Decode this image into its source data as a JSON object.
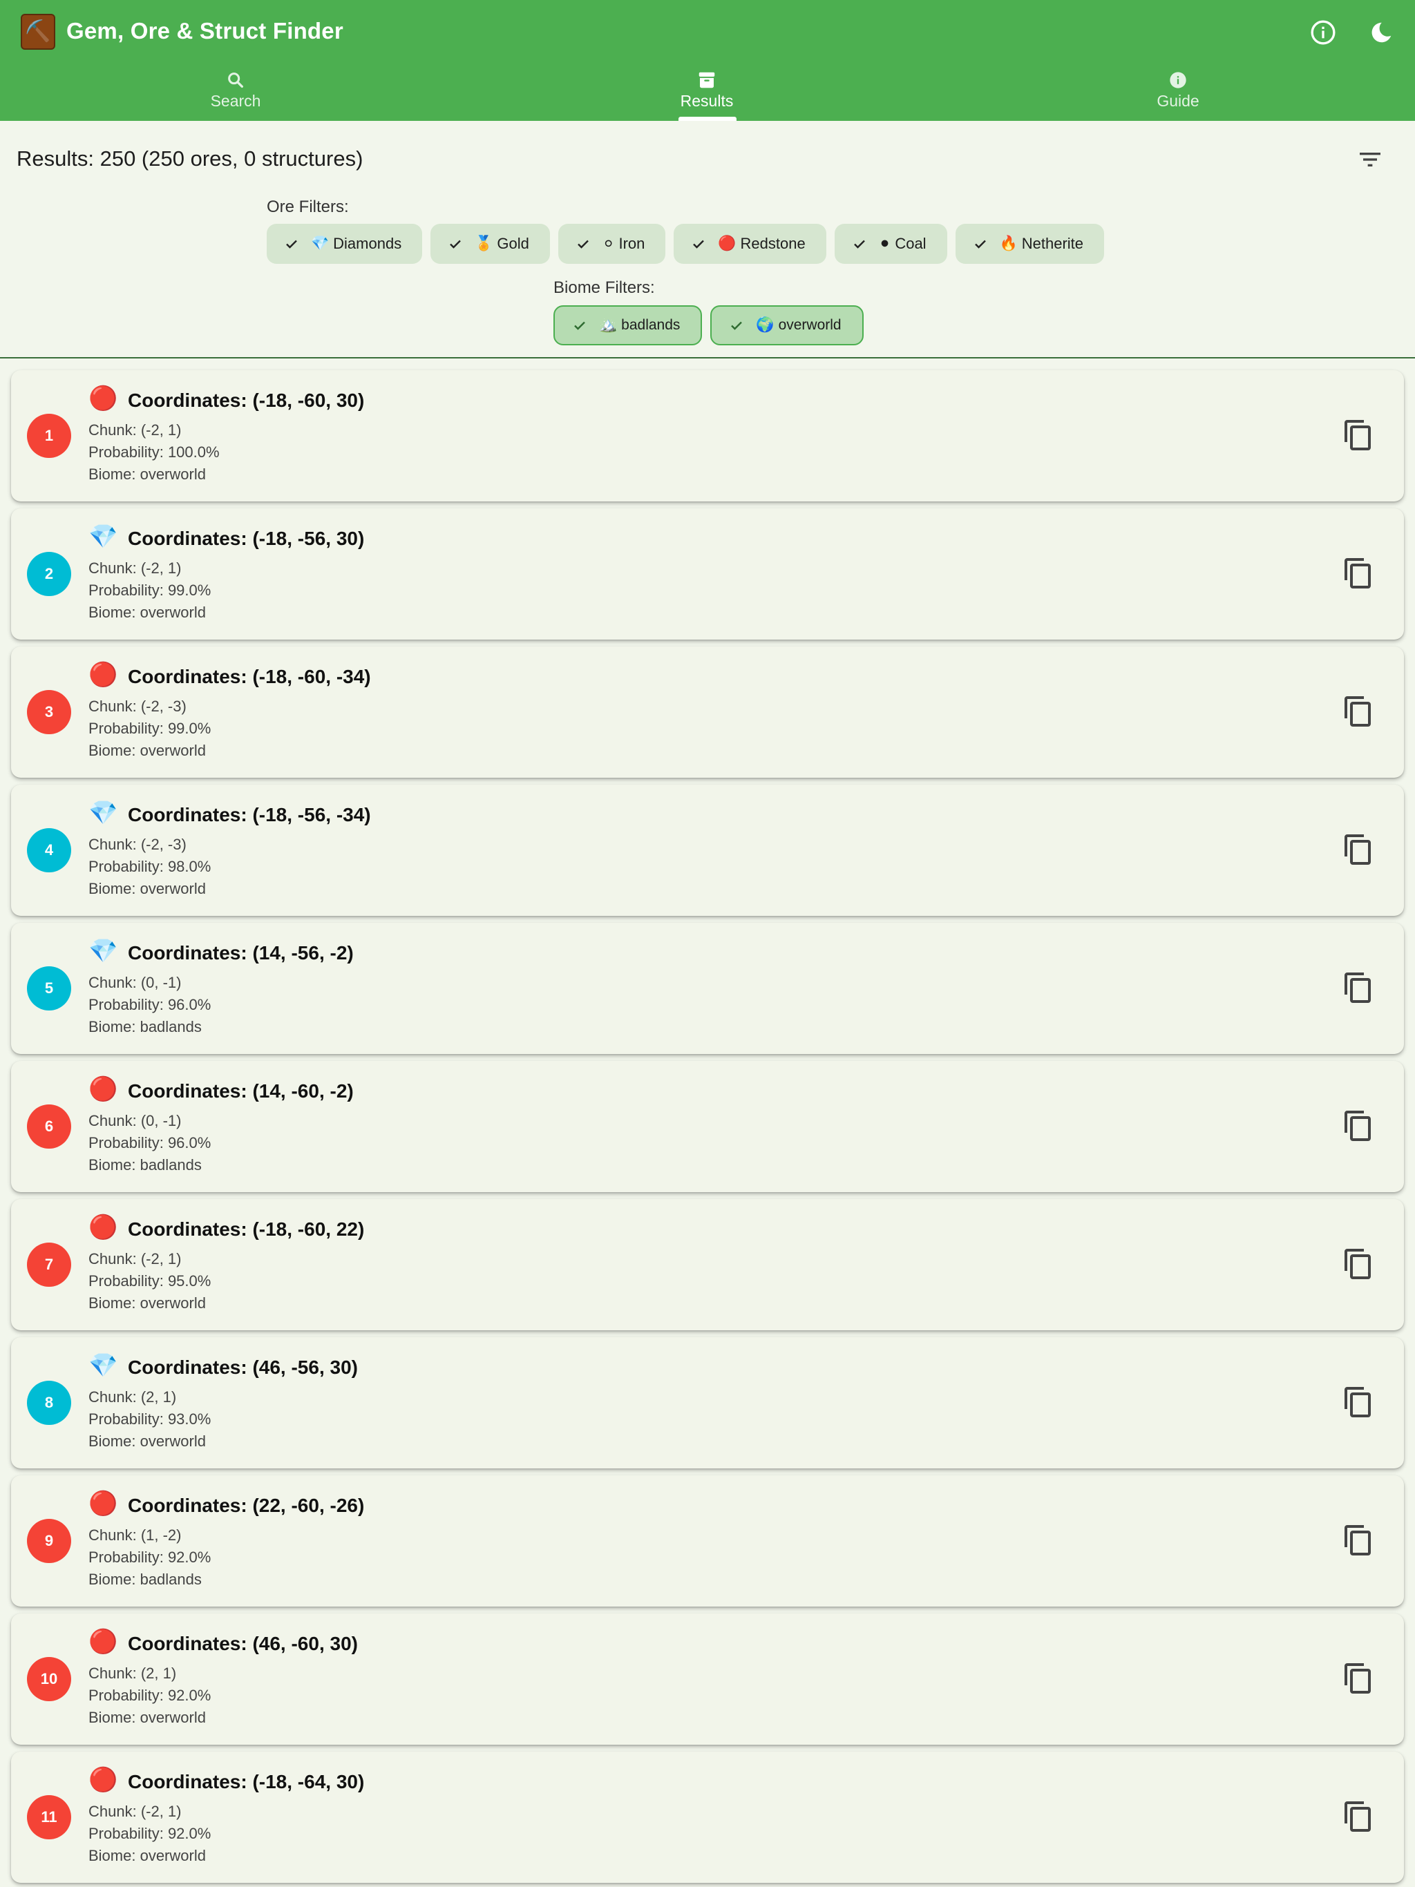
{
  "app": {
    "title": "Gem, Ore & Struct Finder",
    "logo_icon": "⛏️"
  },
  "tabs": [
    {
      "label": "Search",
      "icon": "search-icon"
    },
    {
      "label": "Results",
      "icon": "archive-icon",
      "active": true
    },
    {
      "label": "Guide",
      "icon": "info-icon"
    }
  ],
  "results": {
    "summary": "Results: 250 (250 ores, 0 structures)"
  },
  "filters": {
    "ore_heading": "Ore Filters:",
    "ore_chips": [
      {
        "emoji": "💎",
        "label": "Diamonds"
      },
      {
        "emoji": "🏅",
        "label": "Gold"
      },
      {
        "emoji": "⚪",
        "label": "Iron"
      },
      {
        "emoji": "🔴",
        "label": "Redstone"
      },
      {
        "emoji": "⚫",
        "label": "Coal"
      },
      {
        "emoji": "🔥",
        "label": "Netherite"
      }
    ],
    "biome_heading": "Biome Filters:",
    "biome_chips": [
      {
        "emoji": "🏔️",
        "label": "badlands"
      },
      {
        "emoji": "🌍",
        "label": "overworld"
      }
    ]
  },
  "colors": {
    "primary": "#4caf50",
    "redstone_badge": "#f44336",
    "diamond_badge": "#00bcd4"
  },
  "items": [
    {
      "rank": "1",
      "ore": "redstone",
      "emoji": "🔴",
      "coords": "Coordinates: (-18, -60, 30)",
      "chunk": "Chunk: (-2, 1)",
      "probability": "Probability: 100.0%",
      "biome": "Biome: overworld"
    },
    {
      "rank": "2",
      "ore": "diamond",
      "emoji": "💎",
      "coords": "Coordinates: (-18, -56, 30)",
      "chunk": "Chunk: (-2, 1)",
      "probability": "Probability: 99.0%",
      "biome": "Biome: overworld"
    },
    {
      "rank": "3",
      "ore": "redstone",
      "emoji": "🔴",
      "coords": "Coordinates: (-18, -60, -34)",
      "chunk": "Chunk: (-2, -3)",
      "probability": "Probability: 99.0%",
      "biome": "Biome: overworld"
    },
    {
      "rank": "4",
      "ore": "diamond",
      "emoji": "💎",
      "coords": "Coordinates: (-18, -56, -34)",
      "chunk": "Chunk: (-2, -3)",
      "probability": "Probability: 98.0%",
      "biome": "Biome: overworld"
    },
    {
      "rank": "5",
      "ore": "diamond",
      "emoji": "💎",
      "coords": "Coordinates: (14, -56, -2)",
      "chunk": "Chunk: (0, -1)",
      "probability": "Probability: 96.0%",
      "biome": "Biome: badlands"
    },
    {
      "rank": "6",
      "ore": "redstone",
      "emoji": "🔴",
      "coords": "Coordinates: (14, -60, -2)",
      "chunk": "Chunk: (0, -1)",
      "probability": "Probability: 96.0%",
      "biome": "Biome: badlands"
    },
    {
      "rank": "7",
      "ore": "redstone",
      "emoji": "🔴",
      "coords": "Coordinates: (-18, -60, 22)",
      "chunk": "Chunk: (-2, 1)",
      "probability": "Probability: 95.0%",
      "biome": "Biome: overworld"
    },
    {
      "rank": "8",
      "ore": "diamond",
      "emoji": "💎",
      "coords": "Coordinates: (46, -56, 30)",
      "chunk": "Chunk: (2, 1)",
      "probability": "Probability: 93.0%",
      "biome": "Biome: overworld"
    },
    {
      "rank": "9",
      "ore": "redstone",
      "emoji": "🔴",
      "coords": "Coordinates: (22, -60, -26)",
      "chunk": "Chunk: (1, -2)",
      "probability": "Probability: 92.0%",
      "biome": "Biome: badlands"
    },
    {
      "rank": "10",
      "ore": "redstone",
      "emoji": "🔴",
      "coords": "Coordinates: (46, -60, 30)",
      "chunk": "Chunk: (2, 1)",
      "probability": "Probability: 92.0%",
      "biome": "Biome: overworld"
    },
    {
      "rank": "11",
      "ore": "redstone",
      "emoji": "🔴",
      "coords": "Coordinates: (-18, -64, 30)",
      "chunk": "Chunk: (-2, 1)",
      "probability": "Probability: 92.0%",
      "biome": "Biome: overworld"
    }
  ]
}
